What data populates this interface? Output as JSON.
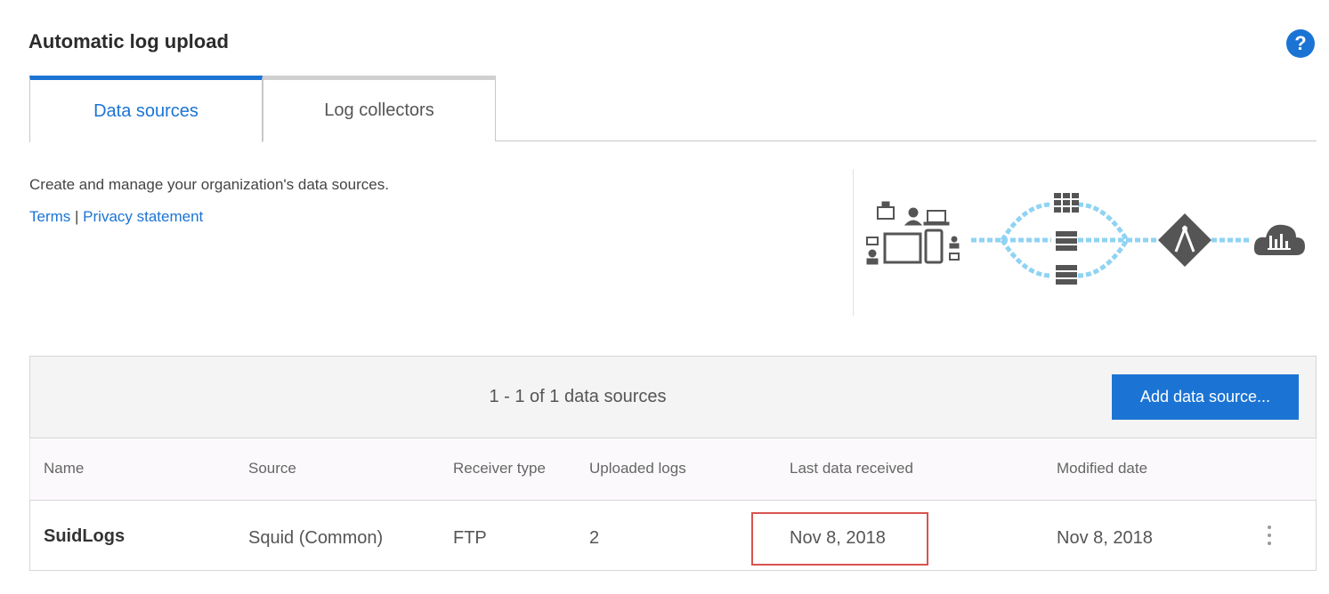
{
  "page": {
    "title": "Automatic log upload",
    "help_icon": "?"
  },
  "tabs": [
    {
      "label": "Data sources",
      "active": true
    },
    {
      "label": "Log collectors",
      "active": false
    }
  ],
  "intro": {
    "description": "Create and manage your organization's data sources.",
    "terms_link": "Terms",
    "separator": "|",
    "privacy_link": "Privacy statement"
  },
  "toolbar": {
    "count_text": "1 - 1 of 1 data sources",
    "add_button_label": "Add data source..."
  },
  "table": {
    "columns": [
      "Name",
      "Source",
      "Receiver type",
      "Uploaded logs",
      "Last data received",
      "Modified date"
    ],
    "rows": [
      {
        "name": "SuidLogs",
        "source": "Squid (Common)",
        "receiver_type": "FTP",
        "uploaded_logs": "2",
        "last_data_received": "Nov 8, 2018",
        "modified_date": "Nov 8, 2018"
      }
    ]
  },
  "colors": {
    "accent": "#1b74d4",
    "highlight": "#d9534f",
    "flow_line": "#8fd3f4",
    "icon_gray": "#555555"
  },
  "illustration_icons": [
    "devices-icon",
    "firewall-rack-icon",
    "log-collector-icon",
    "cloud-analytics-icon"
  ]
}
